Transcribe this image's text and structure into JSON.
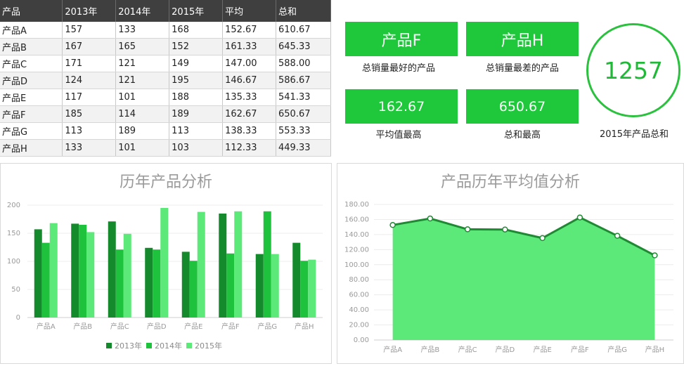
{
  "table": {
    "headers": [
      "产品",
      "2013年",
      "2014年",
      "2015年",
      "平均",
      "总和"
    ],
    "rows": [
      [
        "产品A",
        "157",
        "133",
        "168",
        "152.67",
        "610.67"
      ],
      [
        "产品B",
        "167",
        "165",
        "152",
        "161.33",
        "645.33"
      ],
      [
        "产品C",
        "171",
        "121",
        "149",
        "147.00",
        "588.00"
      ],
      [
        "产品D",
        "124",
        "121",
        "195",
        "146.67",
        "586.67"
      ],
      [
        "产品E",
        "117",
        "101",
        "188",
        "135.33",
        "541.33"
      ],
      [
        "产品F",
        "185",
        "114",
        "189",
        "162.67",
        "650.67"
      ],
      [
        "产品G",
        "113",
        "189",
        "113",
        "138.33",
        "553.33"
      ],
      [
        "产品H",
        "133",
        "101",
        "103",
        "112.33",
        "449.33"
      ]
    ]
  },
  "kpis": {
    "best_value": "产品F",
    "best_caption": "总销量最好的产品",
    "worst_value": "产品H",
    "worst_caption": "总销量最差的产品",
    "avg_value": "162.67",
    "avg_caption": "平均值最高",
    "sum_value": "650.67",
    "sum_caption": "总和最高",
    "total_value": "1257",
    "total_caption": "2015年产品总和"
  },
  "colors": {
    "header_bg": "#3f3f3f",
    "kpi_green": "#1ec83a",
    "series_2013": "#148a2c",
    "series_2014": "#1fc23d",
    "series_2015": "#5de87a",
    "area_fill": "#5de87a",
    "area_line": "#1f8a33"
  },
  "chart_data": [
    {
      "type": "bar",
      "title": "历年产品分析",
      "categories": [
        "产品A",
        "产品B",
        "产品C",
        "产品D",
        "产品E",
        "产品F",
        "产品G",
        "产品H"
      ],
      "series": [
        {
          "name": "2013年",
          "values": [
            157,
            167,
            171,
            124,
            117,
            185,
            113,
            133
          ]
        },
        {
          "name": "2014年",
          "values": [
            133,
            165,
            121,
            121,
            101,
            114,
            189,
            101
          ]
        },
        {
          "name": "2015年",
          "values": [
            168,
            152,
            149,
            195,
            188,
            189,
            113,
            103
          ]
        }
      ],
      "ylim": [
        0,
        200
      ],
      "yticks": [
        "0",
        "50",
        "100",
        "150",
        "200"
      ],
      "grid": true,
      "legend": "bottom"
    },
    {
      "type": "area",
      "title": "产品历年平均值分析",
      "categories": [
        "产品A",
        "产品B",
        "产品C",
        "产品D",
        "产品E",
        "产品F",
        "产品G",
        "产品H"
      ],
      "values": [
        152.67,
        161.33,
        147.0,
        146.67,
        135.33,
        162.67,
        138.33,
        112.33
      ],
      "ylim": [
        0,
        180
      ],
      "yticks": [
        "0.00",
        "20.00",
        "40.00",
        "60.00",
        "80.00",
        "100.00",
        "120.00",
        "140.00",
        "160.00",
        "180.00"
      ],
      "grid": true
    }
  ]
}
